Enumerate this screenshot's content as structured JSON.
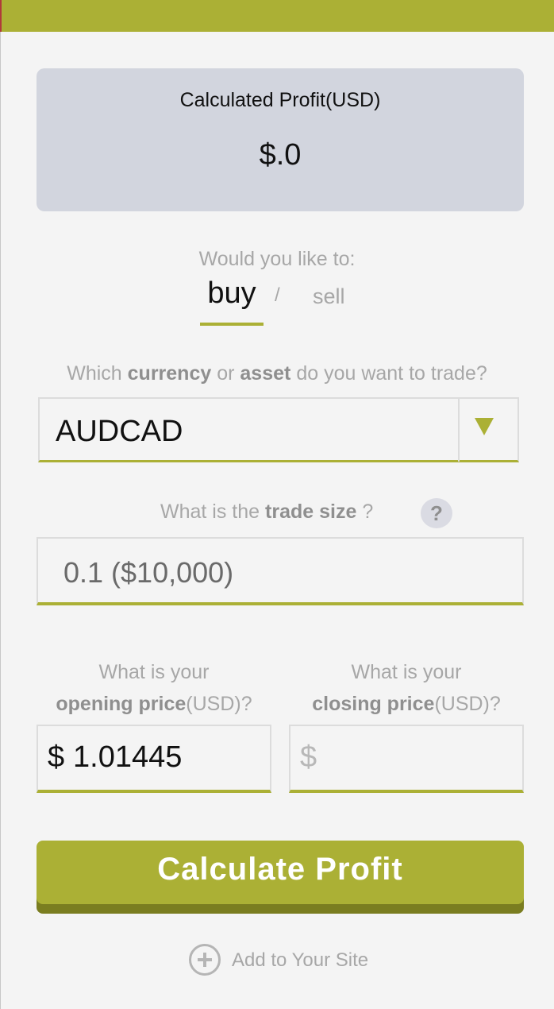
{
  "colors": {
    "accent": "#abb035",
    "accent_dark": "#7a7d20",
    "panel": "#d2d5de",
    "muted_text": "#a7a7a7"
  },
  "profit": {
    "title": "Calculated Profit(USD)",
    "amount": "$.0"
  },
  "direction": {
    "question": "Would you like to:",
    "buy_label": "buy",
    "separator": "/",
    "sell_label": "sell",
    "selected": "buy"
  },
  "currency": {
    "question_prefix": "Which",
    "question_bold1": "currency",
    "question_mid": "or",
    "question_bold2": "asset",
    "question_suffix": "do you want to trade?",
    "selected_value": "AUDCAD",
    "arrow_icon": "caret-down-icon"
  },
  "trade_size": {
    "question_prefix": "What is the",
    "question_bold": "trade size",
    "question_suffix": "?",
    "help_label": "?",
    "value": "0.1 ($10,000)"
  },
  "opening_price": {
    "line1": "What is your",
    "bold": "opening price",
    "suffix": "(USD)?",
    "currency_symbol": "$",
    "value": "1.01445"
  },
  "closing_price": {
    "line1": "What is your",
    "bold": "closing price",
    "suffix": "(USD)?",
    "currency_symbol": "$",
    "value": ""
  },
  "calculate_button": {
    "label": "Calculate Profit"
  },
  "add_to_site": {
    "label": "Add to Your Site",
    "icon": "plus-circle-icon"
  }
}
